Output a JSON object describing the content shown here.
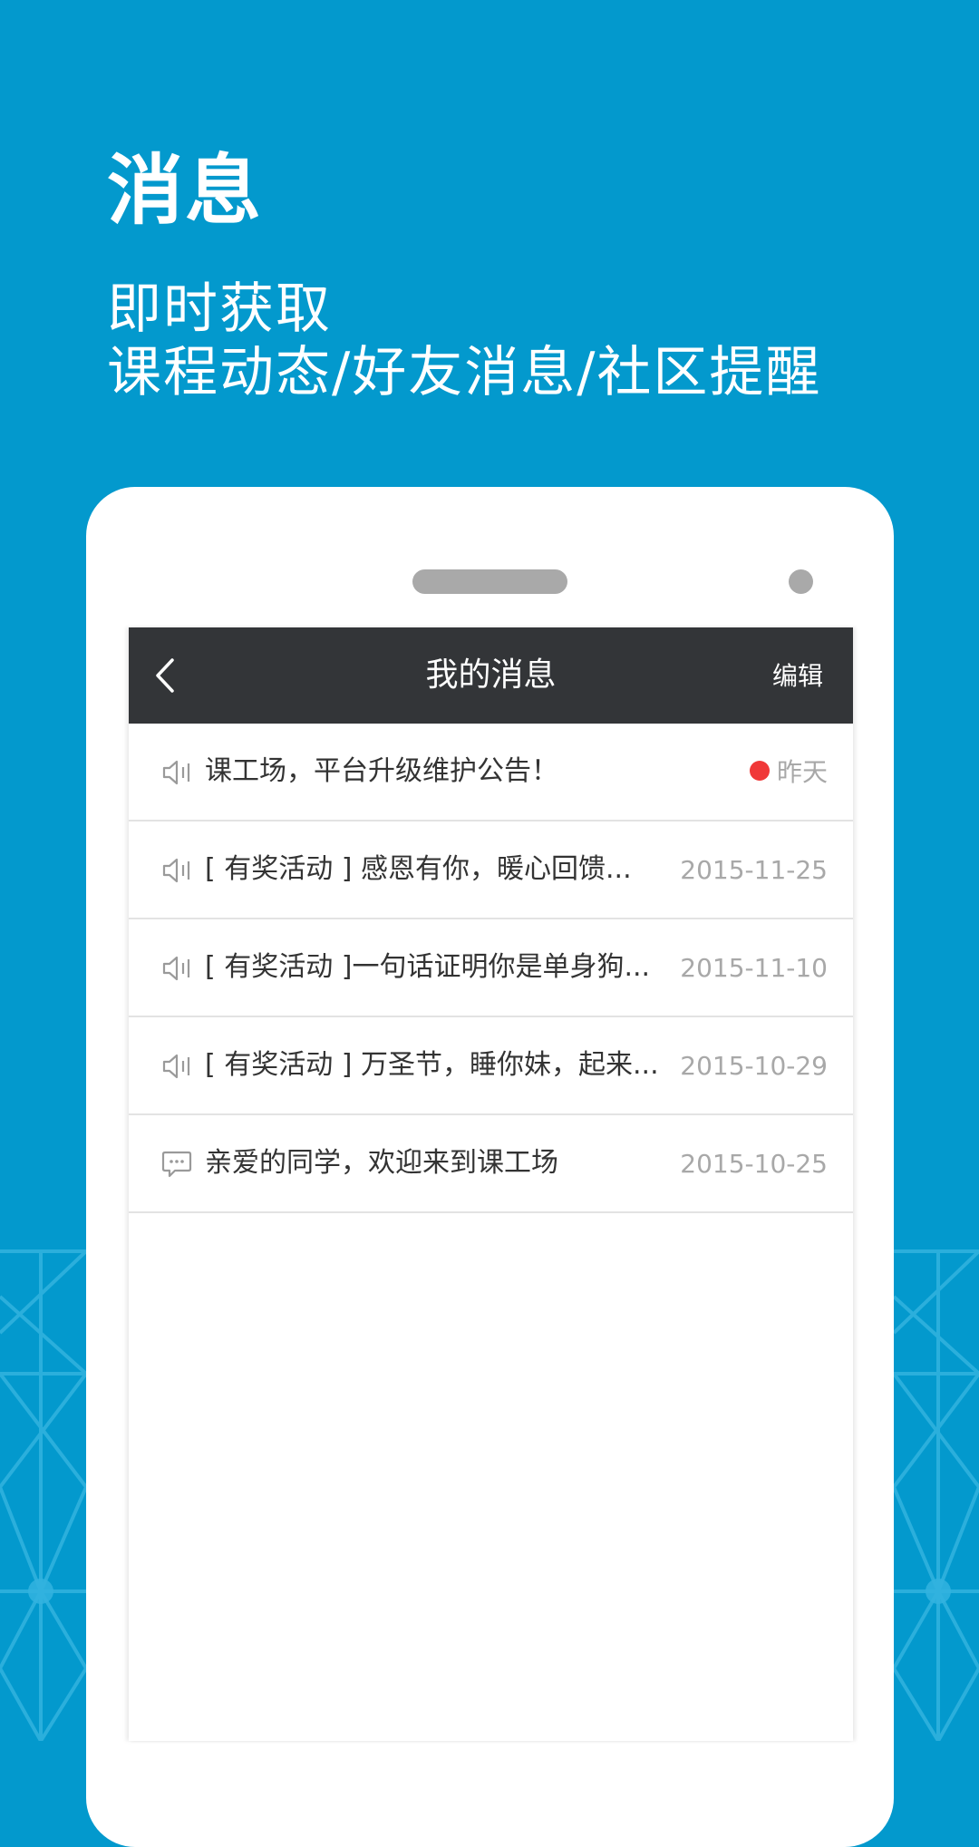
{
  "promo": {
    "title": "消息",
    "subtitle_line1": "即时获取",
    "subtitle_line2": "课程动态/好友消息/社区提醒"
  },
  "colors": {
    "background": "#0399cd",
    "nav_bar": "#333538",
    "unread_dot": "#f03838",
    "date_text": "#a8a8a8"
  },
  "nav": {
    "back_icon": "chevron-left-icon",
    "title": "我的消息",
    "edit_label": "编辑"
  },
  "messages": [
    {
      "icon": "speaker-icon",
      "text": "课工场，平台升级维护公告！",
      "date": "昨天",
      "unread": true
    },
    {
      "icon": "speaker-icon",
      "text": "[ 有奖活动 ] 感恩有你，暖心回馈...",
      "date": "2015-11-25",
      "unread": false
    },
    {
      "icon": "speaker-icon",
      "text": "[ 有奖活动 ]一句话证明你是单身狗...",
      "date": "2015-11-10",
      "unread": false
    },
    {
      "icon": "speaker-icon",
      "text": "[ 有奖活动 ] 万圣节，睡你妹，起来...",
      "date": "2015-10-29",
      "unread": false
    },
    {
      "icon": "chat-bubble-icon",
      "text": "亲爱的同学，欢迎来到课工场",
      "date": "2015-10-25",
      "unread": false
    }
  ]
}
